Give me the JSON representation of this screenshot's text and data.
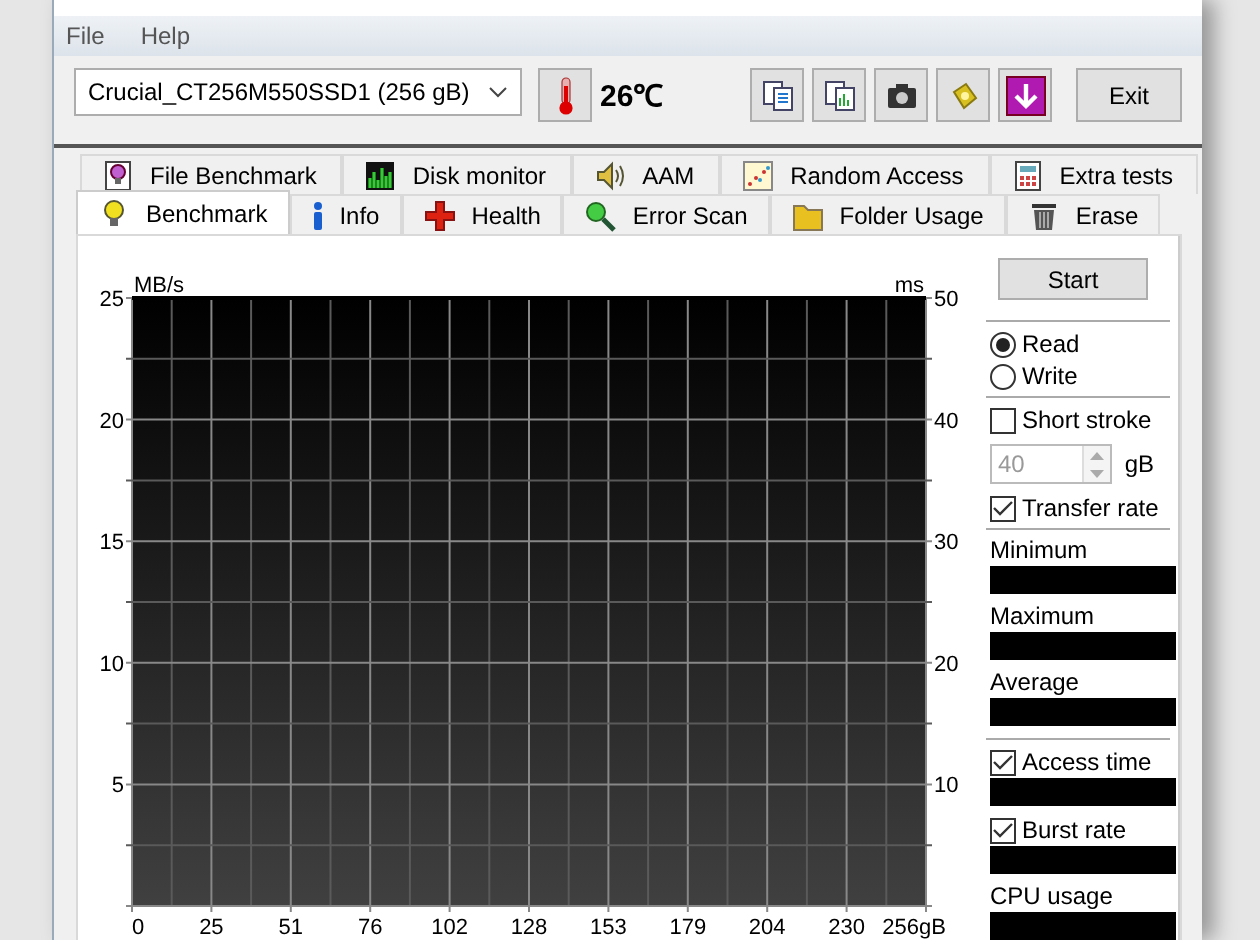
{
  "menu": [
    {
      "label": "File"
    },
    {
      "label": "Help"
    }
  ],
  "toolbar": {
    "drive": "Crucial_CT256M550SSD1 (256 gB)",
    "temperature": "26℃",
    "exit": "Exit"
  },
  "tab_rows": [
    {
      "tabs": [
        {
          "label": "File Benchmark",
          "selected": false
        },
        {
          "label": "Disk monitor",
          "selected": false
        },
        {
          "label": "AAM",
          "selected": false
        },
        {
          "label": "Random Access",
          "selected": false
        },
        {
          "label": "Extra tests",
          "selected": false
        }
      ]
    },
    {
      "tabs": [
        {
          "label": "Benchmark",
          "selected": true
        },
        {
          "label": "Info",
          "selected": false
        },
        {
          "label": "Health",
          "selected": false
        },
        {
          "label": "Error Scan",
          "selected": false
        },
        {
          "label": "Folder Usage",
          "selected": false
        },
        {
          "label": "Erase",
          "selected": false
        }
      ]
    }
  ],
  "chart": {
    "y_unit": "MB/s",
    "y2_unit": "ms",
    "y_ticks": [
      "25",
      "20",
      "15",
      "10",
      "5"
    ],
    "y2_ticks": [
      "50",
      "40",
      "30",
      "20",
      "10"
    ],
    "x_ticks": [
      "0",
      "25",
      "51",
      "76",
      "102",
      "128",
      "153",
      "179",
      "204",
      "230",
      "256gB"
    ]
  },
  "side_groups": [
    [
      {
        "kind": "button",
        "label": "Start"
      }
    ],
    [
      {
        "kind": "radio",
        "label": "Read",
        "selected": true
      },
      {
        "kind": "radio",
        "label": "Write",
        "selected": false
      }
    ],
    [
      {
        "kind": "checkbox",
        "label": "Short stroke",
        "checked": false
      },
      {
        "kind": "spin",
        "value": "40",
        "unit": "gB",
        "disabled": true
      },
      {
        "kind": "checkbox",
        "label": "Transfer rate",
        "checked": true
      }
    ],
    [
      {
        "kind": "label",
        "label": "Minimum"
      },
      {
        "kind": "readout"
      },
      {
        "kind": "label",
        "label": "Maximum"
      },
      {
        "kind": "readout"
      },
      {
        "kind": "label",
        "label": "Average"
      },
      {
        "kind": "readout"
      }
    ],
    [
      {
        "kind": "checkbox",
        "label": "Access time",
        "checked": true
      },
      {
        "kind": "readout"
      },
      {
        "kind": "checkbox",
        "label": "Burst rate",
        "checked": true
      },
      {
        "kind": "readout"
      },
      {
        "kind": "label",
        "label": "CPU usage"
      },
      {
        "kind": "readout"
      }
    ]
  ]
}
